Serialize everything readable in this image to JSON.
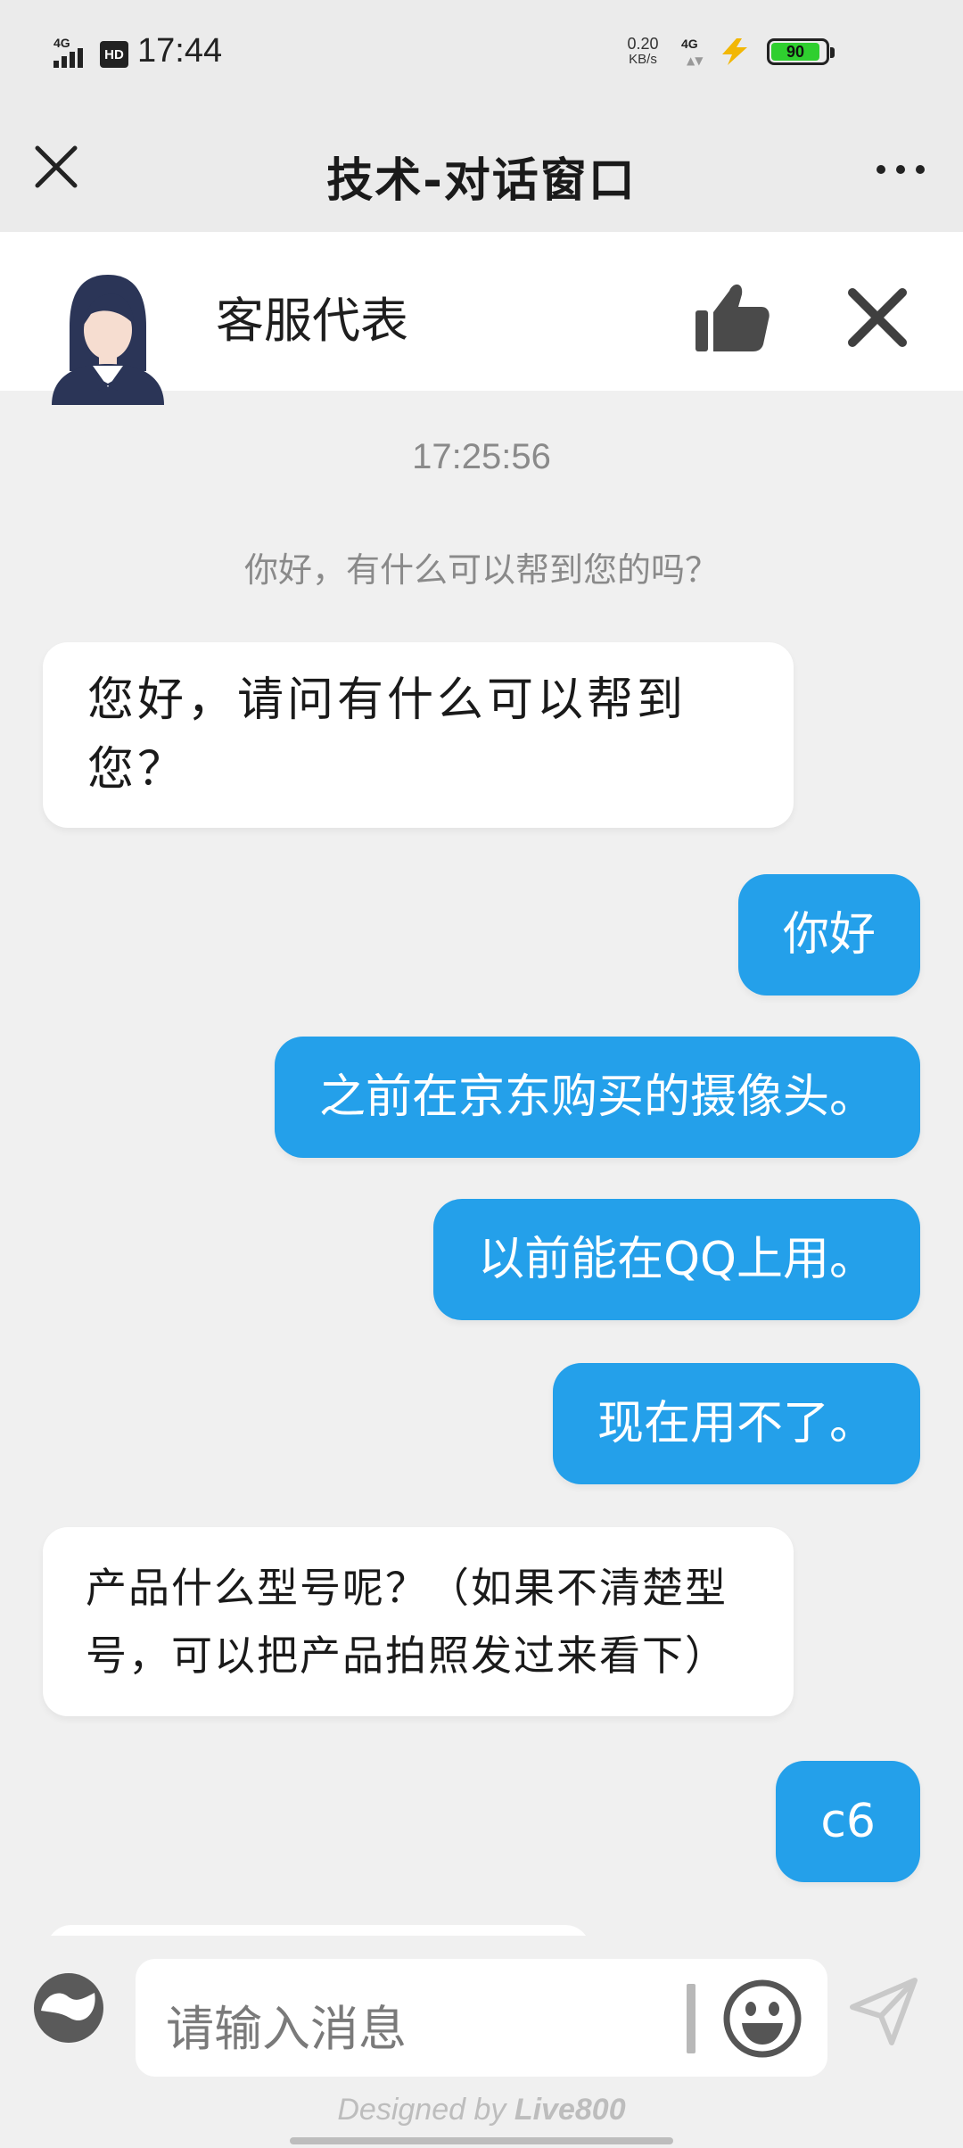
{
  "status_bar": {
    "network_left": "4G",
    "hd_badge": "HD",
    "time": "17:44",
    "net_speed_value": "0.20",
    "net_speed_unit": "KB/s",
    "network_right": "4G",
    "battery_level": "90",
    "battery_color": "#2fcf2f"
  },
  "nav": {
    "title": "技术-对话窗口",
    "close_icon": "close-icon",
    "more_icon": "more-icon"
  },
  "agent": {
    "name": "客服代表",
    "avatar_icon": "agent-avatar",
    "thumb_icon": "thumbs-up-icon",
    "close_icon": "close-icon"
  },
  "chat": {
    "timestamp": "17:25:56",
    "system_message": "你好，有什么可以帮到您的吗？",
    "messages": [
      {
        "from": "agent",
        "text": "您好，请问有什么可以帮到您？"
      },
      {
        "from": "user",
        "text": "你好"
      },
      {
        "from": "user",
        "text": "之前在京东购买的摄像头。"
      },
      {
        "from": "user",
        "text": "以前能在QQ上用。"
      },
      {
        "from": "user",
        "text": "现在用不了。"
      },
      {
        "from": "agent",
        "text": "产品什么型号呢？（如果不清楚型号，可以把产品拍照发过来看下）"
      },
      {
        "from": "user",
        "text": "c6"
      }
    ],
    "user_bubble_color": "#24a0ea",
    "agent_bubble_color": "#ffffff"
  },
  "input": {
    "placeholder": "请输入消息",
    "voice_icon": "voice-toggle-icon",
    "emoji_icon": "emoji-icon",
    "send_icon": "send-icon"
  },
  "footer": {
    "prefix": "Designed by ",
    "brand": "Live800"
  }
}
